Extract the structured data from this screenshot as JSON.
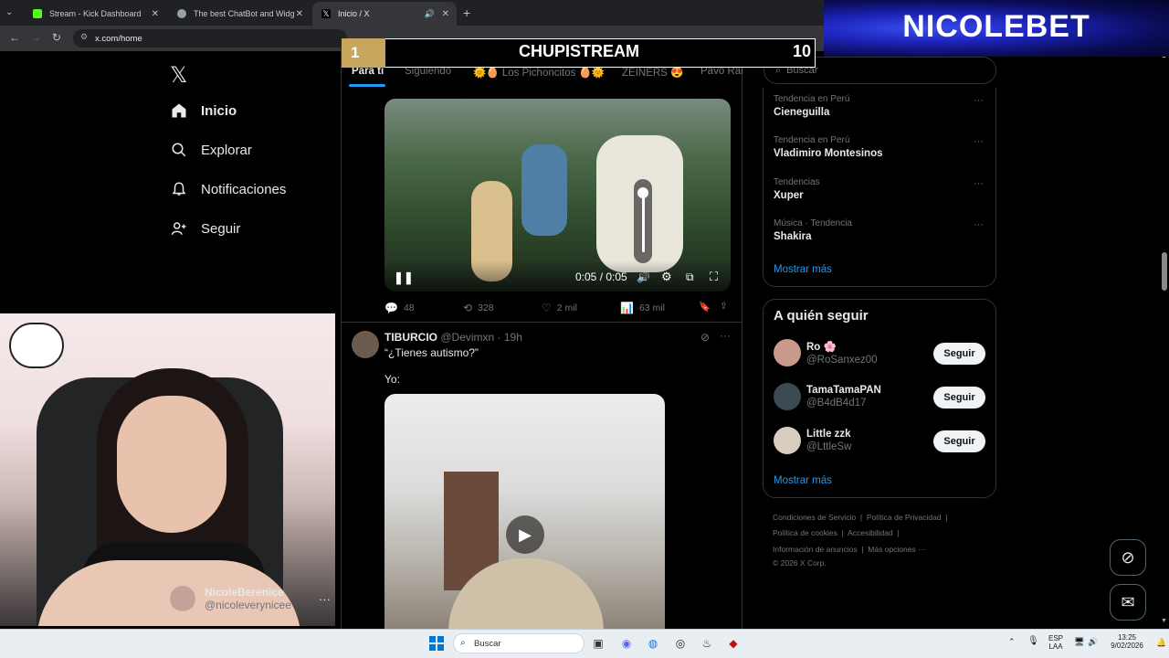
{
  "browser": {
    "tabs": [
      {
        "title": "Stream - Kick Dashboard",
        "favicon_color": "#53fc18"
      },
      {
        "title": "The best ChatBot and Widgets",
        "favicon_color": "#9aa0a6"
      },
      {
        "title": "Inicio / X",
        "favicon_color": "#e8eaed"
      }
    ],
    "new_tab": "+",
    "url": "x.com/home"
  },
  "sidebar": {
    "logo": "𝕏",
    "items": [
      {
        "label": "Inicio",
        "icon": "home-icon"
      },
      {
        "label": "Explorar",
        "icon": "search-icon"
      },
      {
        "label": "Notificaciones",
        "icon": "bell-icon"
      },
      {
        "label": "Seguir",
        "icon": "person-plus-icon"
      }
    ],
    "user": {
      "name": "NicoleBerenice",
      "handle": "@nicoleverynicee",
      "more": "···"
    }
  },
  "feed": {
    "tabs": [
      "Para ti",
      "Siguiendo",
      "🌞🥚 Los Pichoncitos 🥚🌞",
      "ZEINERS 😍",
      "Pavo Rai"
    ],
    "post1": {
      "video_time": "0:05 / 0:05",
      "actions": {
        "replies": "48",
        "reposts": "328",
        "likes": "2 mil",
        "views": "63 mil"
      }
    },
    "post2": {
      "name": "TIBURCIO",
      "handle": "@Devimxn",
      "time": "· 19h",
      "text1": "“¿Tienes autismo?”",
      "text2": "Yo:"
    }
  },
  "right": {
    "search_placeholder": "Buscar",
    "trends": [
      {
        "context": "Tendencia en Perú",
        "title": "Cieneguilla"
      },
      {
        "context": "Tendencia en Perú",
        "title": "Vladimiro Montesinos"
      },
      {
        "context": "Tendencias",
        "title": "Xuper"
      },
      {
        "context": "Música · Tendencia",
        "title": "Shakira"
      }
    ],
    "show_more": "Mostrar más",
    "who_to_follow_title": "A quién seguir",
    "suggestions": [
      {
        "name": "Ro 🌸",
        "handle": "@RoSanxez00",
        "button": "Seguir",
        "avatar_color": "#c99a8c"
      },
      {
        "name": "TamaTamaPAN",
        "handle": "@B4dB4d17",
        "button": "Seguir",
        "avatar_color": "#3b4a52"
      },
      {
        "name": "Little zzk",
        "handle": "@LttleSw",
        "button": "Seguir",
        "avatar_color": "#d9cdbf"
      }
    ],
    "footer": {
      "line1": [
        "Condiciones de Servicio",
        "Política de Privacidad"
      ],
      "line2": [
        "Política de cookies",
        "Accesibilidad"
      ],
      "line3": [
        "Información de anuncios",
        "Más opciones ···"
      ],
      "copyright": "© 2026 X Corp."
    }
  },
  "overlay": {
    "score_left": "1",
    "score_title": "CHUPISTREAM",
    "score_right": "10",
    "brand": "NICOLEBET"
  },
  "taskbar": {
    "search_placeholder": "Buscar",
    "lang_top": "ESP",
    "lang_bottom": "LAA",
    "time": "13:25",
    "date": "9/02/2026"
  }
}
